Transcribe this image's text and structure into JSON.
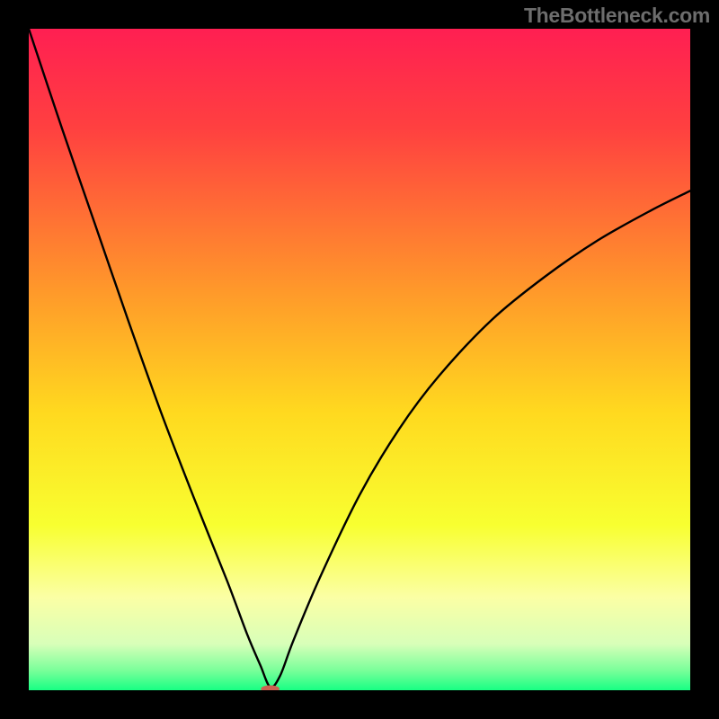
{
  "attribution": "TheBottleneck.com",
  "chart_data": {
    "type": "line",
    "title": "",
    "xlabel": "",
    "ylabel": "",
    "xlim": [
      0,
      100
    ],
    "ylim": [
      0,
      100
    ],
    "gradient_stops": [
      {
        "offset": 0,
        "color": "#ff1f52"
      },
      {
        "offset": 0.15,
        "color": "#ff4040"
      },
      {
        "offset": 0.4,
        "color": "#ff9a2a"
      },
      {
        "offset": 0.58,
        "color": "#ffd91f"
      },
      {
        "offset": 0.75,
        "color": "#f8ff30"
      },
      {
        "offset": 0.86,
        "color": "#fbffa5"
      },
      {
        "offset": 0.93,
        "color": "#d8ffb9"
      },
      {
        "offset": 0.97,
        "color": "#7aff9a"
      },
      {
        "offset": 1.0,
        "color": "#18ff84"
      }
    ],
    "series": [
      {
        "name": "bottleneck-curve",
        "x": [
          0.0,
          5,
          10,
          15,
          20,
          25,
          30,
          33,
          35,
          36.5,
          38,
          40,
          44,
          50,
          56,
          62,
          70,
          78,
          86,
          94,
          100
        ],
        "y": [
          100,
          85,
          70.5,
          56,
          42,
          29,
          16.5,
          8.5,
          3.8,
          0.5,
          2.2,
          7.5,
          17,
          29.5,
          39.5,
          47.5,
          56,
          62.5,
          68,
          72.5,
          75.5
        ]
      }
    ],
    "markers": [
      {
        "name": "min-marker",
        "x": 36.5,
        "y": 0.2,
        "rx": 1.4,
        "ry": 0.55,
        "color": "#cc6152"
      }
    ]
  }
}
